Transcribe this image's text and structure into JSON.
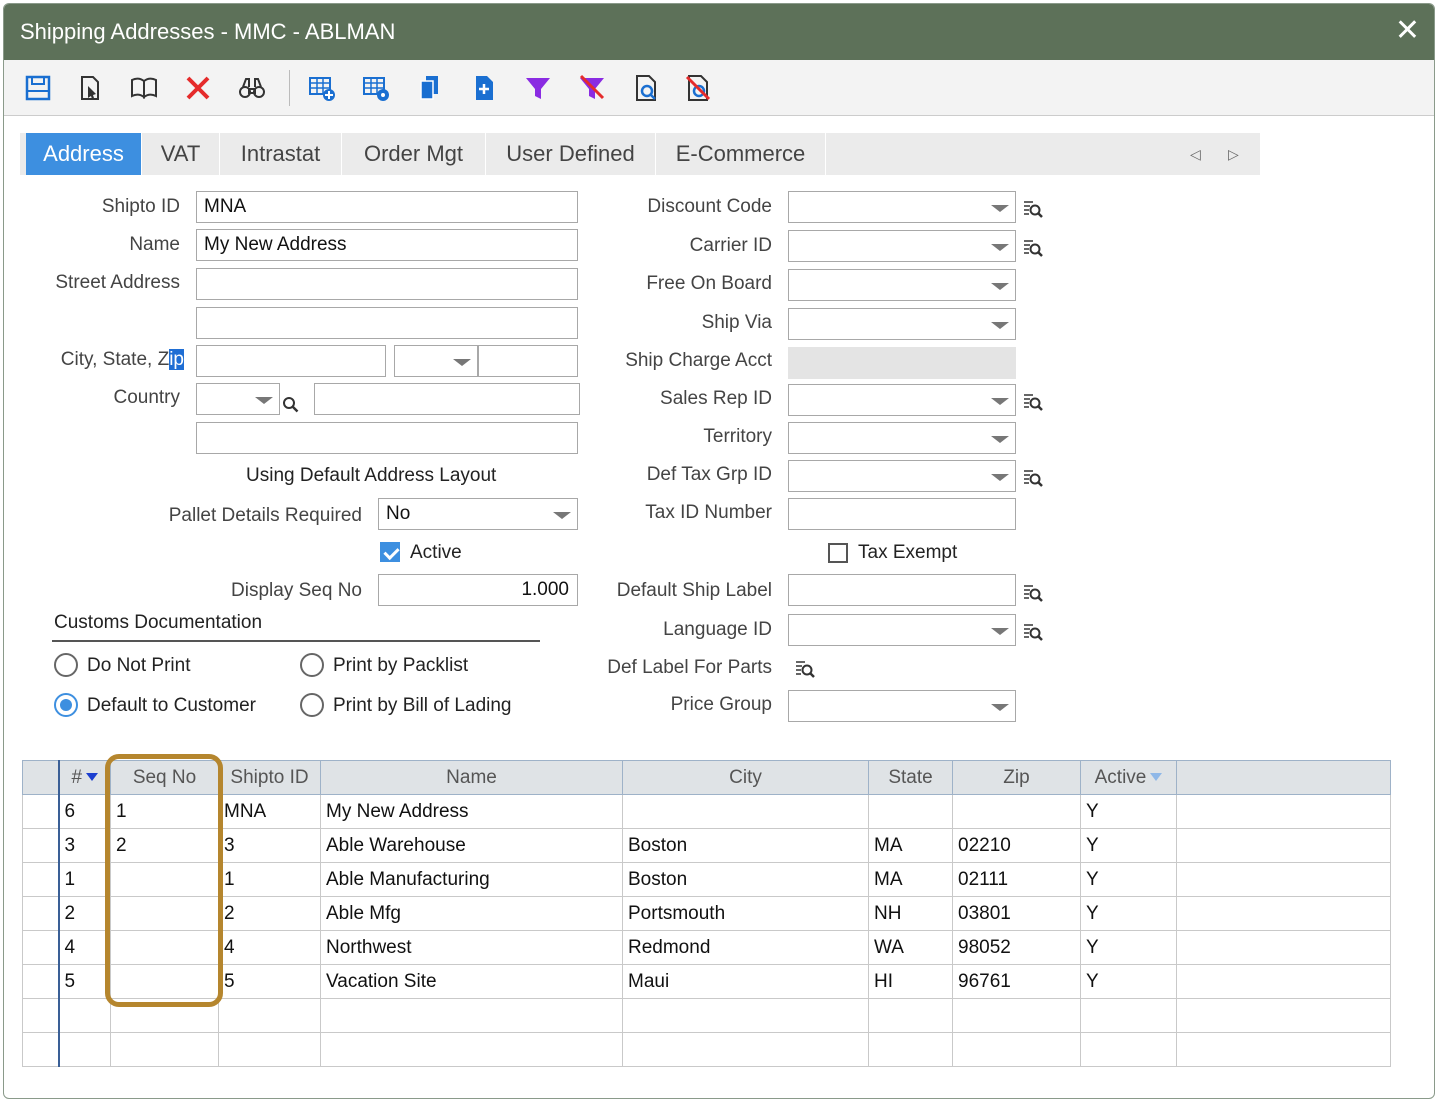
{
  "window": {
    "title": "Shipping Addresses - MMC - ABLMAN",
    "close_glyph": "✕"
  },
  "toolbar": {
    "buttons": [
      {
        "name": "save-icon",
        "color": "#1a6fd1"
      },
      {
        "name": "edit-icon",
        "color": "#333333"
      },
      {
        "name": "book-icon",
        "color": "#333333"
      },
      {
        "name": "delete-icon",
        "color": "#e52b2b"
      },
      {
        "name": "binoculars-icon",
        "color": "#333333"
      },
      {
        "name": "grid-add-icon",
        "color": "#1a6fd1"
      },
      {
        "name": "grid-settings-icon",
        "color": "#1a6fd1"
      },
      {
        "name": "copy-icon",
        "color": "#1a6fd1"
      },
      {
        "name": "new-document-icon",
        "color": "#1a6fd1"
      },
      {
        "name": "filter-icon",
        "color": "#8a2be2"
      },
      {
        "name": "clear-filter-icon",
        "color": "#e52b2b"
      },
      {
        "name": "preview-icon",
        "color": "#1a6fd1"
      },
      {
        "name": "no-preview-icon",
        "color": "#e52b2b"
      }
    ]
  },
  "tabs": [
    {
      "label": "Address",
      "active": true
    },
    {
      "label": "VAT"
    },
    {
      "label": "Intrastat"
    },
    {
      "label": "Order Mgt"
    },
    {
      "label": "User Defined"
    },
    {
      "label": "E-Commerce"
    }
  ],
  "tab_nav": {
    "prev": "◁",
    "next": "▷"
  },
  "left_form": {
    "shipto_id_label": "Shipto ID",
    "shipto_id_value": "MNA",
    "name_label": "Name",
    "name_value": "My New Address",
    "street_label": "Street Address",
    "street_line1": "",
    "street_line2": "",
    "city_state_zip_label": "City, State, Z",
    "city_state_zip_label_caret": "ip",
    "city_value": "",
    "state_value": "",
    "zip_value": "",
    "country_label": "Country",
    "country_code": "",
    "country_name": "",
    "country_extra": "",
    "address_layout_text": "Using Default Address Layout",
    "pallet_label": "Pallet Details Required",
    "pallet_value": "No",
    "active_label": "Active",
    "active_checked": true,
    "display_seq_label": "Display Seq No",
    "display_seq_value": "1.000",
    "customs_heading": "Customs Documentation",
    "customs_options": [
      {
        "label": "Do Not Print",
        "selected": false
      },
      {
        "label": "Print by Packlist",
        "selected": false
      },
      {
        "label": "Default to Customer",
        "selected": true
      },
      {
        "label": "Print by Bill of Lading",
        "selected": false
      }
    ]
  },
  "right_form": {
    "discount_code_label": "Discount Code",
    "carrier_id_label": "Carrier ID",
    "fob_label": "Free On Board",
    "ship_via_label": "Ship Via",
    "ship_charge_label": "Ship Charge Acct",
    "sales_rep_label": "Sales Rep ID",
    "territory_label": "Territory",
    "def_tax_grp_label": "Def Tax Grp ID",
    "tax_id_label": "Tax ID Number",
    "tax_exempt_label": "Tax Exempt",
    "tax_exempt_checked": false,
    "default_ship_label_label": "Default Ship Label",
    "language_id_label": "Language ID",
    "def_label_parts_label": "Def Label For Parts",
    "price_group_label": "Price Group"
  },
  "grid": {
    "columns": [
      "#",
      "Seq No",
      "Shipto ID",
      "Name",
      "City",
      "State",
      "Zip",
      "Active"
    ],
    "rows": [
      [
        "6",
        "1",
        "MNA",
        "My New Address",
        "",
        "",
        "",
        "Y"
      ],
      [
        "3",
        "2",
        "3",
        "Able Warehouse",
        "Boston",
        "MA",
        "02210",
        "Y"
      ],
      [
        "1",
        "",
        "1",
        "Able Manufacturing",
        "Boston",
        "MA",
        "02111",
        "Y"
      ],
      [
        "2",
        "",
        "2",
        "Able Mfg",
        "Portsmouth",
        "NH",
        "03801",
        "Y"
      ],
      [
        "4",
        "",
        "4",
        "Northwest",
        "Redmond",
        "WA",
        "98052",
        "Y"
      ],
      [
        "5",
        "",
        "5",
        "Vacation Site",
        "Maui",
        "HI",
        "96761",
        "Y"
      ],
      [
        "",
        "",
        "",
        "",
        "",
        "",
        "",
        ""
      ],
      [
        "",
        "",
        "",
        "",
        "",
        "",
        "",
        ""
      ]
    ],
    "highlight_column": "Seq No",
    "highlight_color": "#b5862e"
  }
}
